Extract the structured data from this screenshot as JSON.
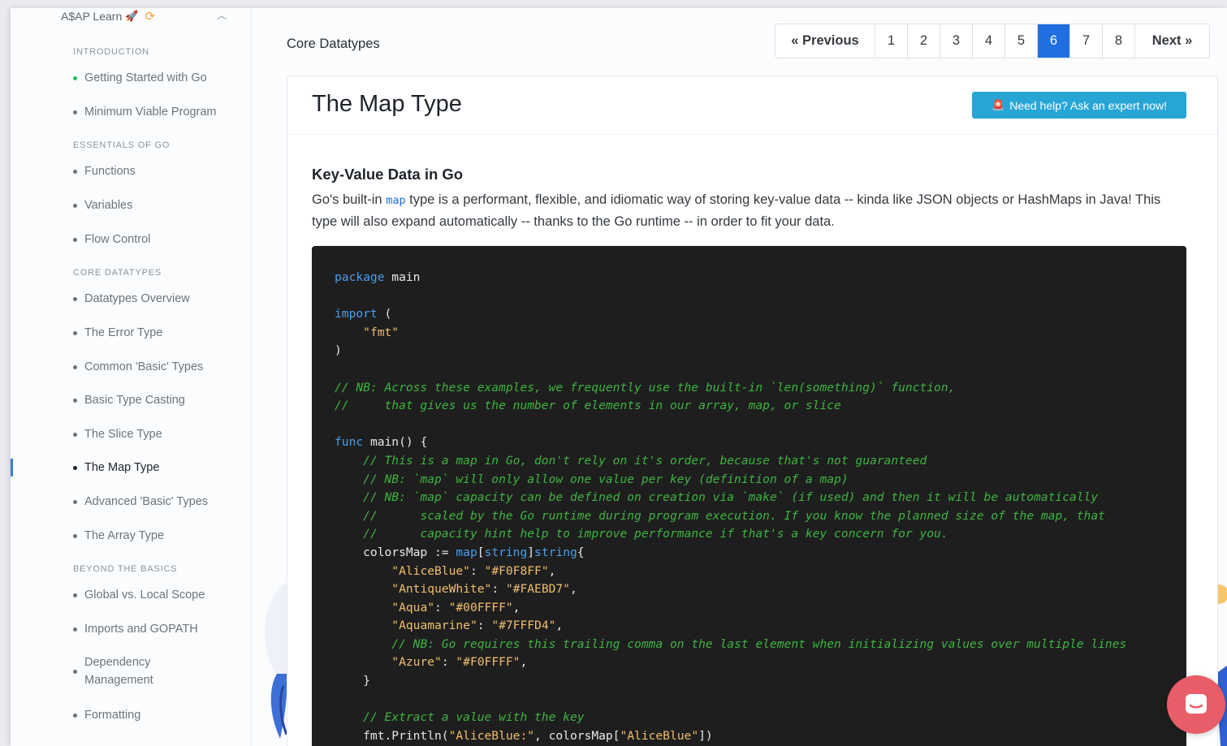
{
  "sidebar": {
    "brand": "A$AP Learn",
    "sections": [
      {
        "label": "INTRODUCTION",
        "items": [
          {
            "label": "Getting Started with Go",
            "status": "green"
          },
          {
            "label": "Minimum Viable Program"
          }
        ]
      },
      {
        "label": "ESSENTIALS OF GO",
        "items": [
          {
            "label": "Functions"
          },
          {
            "label": "Variables"
          },
          {
            "label": "Flow Control"
          }
        ]
      },
      {
        "label": "CORE DATATYPES",
        "items": [
          {
            "label": "Datatypes Overview"
          },
          {
            "label": "The Error Type"
          },
          {
            "label": "Common 'Basic' Types"
          },
          {
            "label": "Basic Type Casting"
          },
          {
            "label": "The Slice Type"
          },
          {
            "label": "The Map Type",
            "active": true
          },
          {
            "label": "Advanced 'Basic' Types"
          },
          {
            "label": "The Array Type"
          }
        ]
      },
      {
        "label": "BEYOND THE BASICS",
        "items": [
          {
            "label": "Global vs. Local Scope"
          },
          {
            "label": "Imports and GOPATH"
          },
          {
            "label": "Dependency Management"
          },
          {
            "label": "Formatting"
          }
        ]
      }
    ]
  },
  "header": {
    "breadcrumb": "Core Datatypes"
  },
  "pagination": {
    "prev_label": "« Previous",
    "next_label": "Next »",
    "pages": [
      "1",
      "2",
      "3",
      "4",
      "5",
      "6",
      "7",
      "8"
    ],
    "current": "6"
  },
  "lesson": {
    "title": "The Map Type",
    "help_button": "Need help? Ask an expert now!",
    "section_title": "Key-Value Data in Go",
    "intro_before": "Go's built-in ",
    "intro_code": "map",
    "intro_after": " type is a performant, flexible, and idiomatic way of storing key-value data -- kinda like JSON objects or HashMaps in Java! This type will also expand automatically -- thanks to the Go runtime -- in order to fit your data."
  },
  "code": {
    "lines": [
      [
        [
          "kw",
          "package"
        ],
        [
          "txt",
          " main"
        ]
      ],
      [],
      [
        [
          "kw",
          "import"
        ],
        [
          "txt",
          " ("
        ]
      ],
      [
        [
          "txt",
          "    "
        ],
        [
          "str",
          "\"fmt\""
        ]
      ],
      [
        [
          "txt",
          ")"
        ]
      ],
      [],
      [
        [
          "cmt",
          "// NB: Across these examples, we frequently use the built-in `len(something)` function,"
        ]
      ],
      [
        [
          "cmt",
          "//     that gives us the number of elements in our array, map, or slice"
        ]
      ],
      [],
      [
        [
          "kw",
          "func"
        ],
        [
          "txt",
          " main() {"
        ]
      ],
      [
        [
          "txt",
          "    "
        ],
        [
          "cmt",
          "// This is a map in Go, don't rely on it's order, because that's not guaranteed"
        ]
      ],
      [
        [
          "txt",
          "    "
        ],
        [
          "cmt",
          "// NB: `map` will only allow one value per key (definition of a map)"
        ]
      ],
      [
        [
          "txt",
          "    "
        ],
        [
          "cmt",
          "// NB: `map` capacity can be defined on creation via `make` (if used) and then it will be automatically"
        ]
      ],
      [
        [
          "txt",
          "    "
        ],
        [
          "cmt",
          "//      scaled by the Go runtime during program execution. If you know the planned size of the map, that"
        ]
      ],
      [
        [
          "txt",
          "    "
        ],
        [
          "cmt",
          "//      capacity hint help to improve performance if that's a key concern for you."
        ]
      ],
      [
        [
          "txt",
          "    colorsMap := "
        ],
        [
          "kw",
          "map"
        ],
        [
          "txt",
          "["
        ],
        [
          "kw",
          "string"
        ],
        [
          "txt",
          "]"
        ],
        [
          "kw",
          "string"
        ],
        [
          "txt",
          "{"
        ]
      ],
      [
        [
          "txt",
          "        "
        ],
        [
          "str",
          "\"AliceBlue\""
        ],
        [
          "txt",
          ": "
        ],
        [
          "str",
          "\"#F0F8FF\""
        ],
        [
          "txt",
          ","
        ]
      ],
      [
        [
          "txt",
          "        "
        ],
        [
          "str",
          "\"AntiqueWhite\""
        ],
        [
          "txt",
          ": "
        ],
        [
          "str",
          "\"#FAEBD7\""
        ],
        [
          "txt",
          ","
        ]
      ],
      [
        [
          "txt",
          "        "
        ],
        [
          "str",
          "\"Aqua\""
        ],
        [
          "txt",
          ": "
        ],
        [
          "str",
          "\"#00FFFF\""
        ],
        [
          "txt",
          ","
        ]
      ],
      [
        [
          "txt",
          "        "
        ],
        [
          "str",
          "\"Aquamarine\""
        ],
        [
          "txt",
          ": "
        ],
        [
          "str",
          "\"#7FFFD4\""
        ],
        [
          "txt",
          ","
        ]
      ],
      [
        [
          "txt",
          "        "
        ],
        [
          "cmt",
          "// NB: Go requires this trailing comma on the last element when initializing values over multiple lines"
        ]
      ],
      [
        [
          "txt",
          "        "
        ],
        [
          "str",
          "\"Azure\""
        ],
        [
          "txt",
          ": "
        ],
        [
          "str",
          "\"#F0FFFF\""
        ],
        [
          "txt",
          ","
        ]
      ],
      [
        [
          "txt",
          "    }"
        ]
      ],
      [],
      [
        [
          "txt",
          "    "
        ],
        [
          "cmt",
          "// Extract a value with the key"
        ]
      ],
      [
        [
          "txt",
          "    fmt.Println("
        ],
        [
          "str",
          "\"AliceBlue:\""
        ],
        [
          "txt",
          ", colorsMap["
        ],
        [
          "str",
          "\"AliceBlue\""
        ],
        [
          "txt",
          "])"
        ]
      ]
    ]
  },
  "colors": {
    "accent": "#1f6fe0",
    "help_button": "#27a6d6",
    "code_bg": "#1e1e1f",
    "chat_bubble": "#e85d68",
    "status_green": "#20c064"
  },
  "icons": {
    "brand_rocket": "rocket-icon",
    "brand_sync": "sync-icon",
    "collapse": "chevron-up-icon",
    "help": "alarm-icon",
    "chat": "chat-icon"
  }
}
